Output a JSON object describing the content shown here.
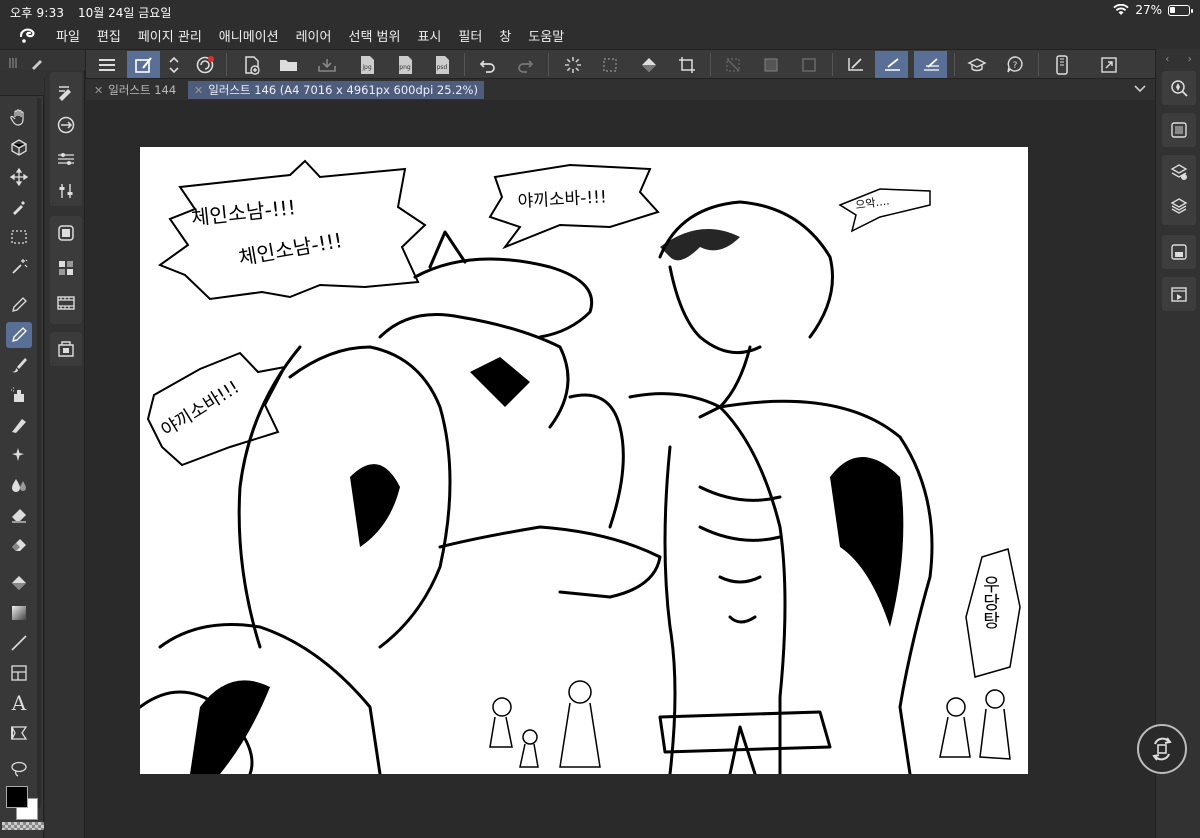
{
  "status_bar": {
    "time": "오후 9:33",
    "date": "10월 24일 금요일",
    "battery_percent": "27%",
    "battery_level": 0.27
  },
  "menu": {
    "items": [
      "파일",
      "편집",
      "페이지 관리",
      "애니메이션",
      "레이어",
      "선택 범위",
      "표시",
      "필터",
      "창",
      "도움말"
    ]
  },
  "toolbar": {
    "icons": [
      "menu-icon",
      "select-tool-icon",
      "updown-icon",
      "clip-studio-icon",
      "new-file-icon",
      "open-folder-icon",
      "save-icon",
      "export-jpg-icon",
      "export-png-icon",
      "export-psd-icon",
      "undo-icon",
      "redo-icon",
      "loading-icon",
      "transform-icon",
      "fill-icon",
      "crop-icon",
      "clear-icon",
      "fill-gray-icon",
      "border-icon",
      "snap-ruler-icon",
      "snap-special-icon",
      "snap-grid-icon",
      "learn-icon",
      "help-icon",
      "smartphone-icon",
      "expand-icon"
    ],
    "export_labels": {
      "jpg": "jpg",
      "png": "png",
      "psd": "psd"
    }
  },
  "tabs": [
    {
      "label": "일러스트 144",
      "active": false
    },
    {
      "label": "일러스트 146 (A4 7016 x 4961px 600dpi 25.2%)",
      "active": true
    }
  ],
  "canvas": {
    "bubbles": {
      "b1_line1": "체인소남-!!!",
      "b1_line2": "체인소남-!!!",
      "b2": "야끼소바-!!!",
      "b3": "야끼소바!!!",
      "b4": "으악....",
      "b5": "우당탕"
    }
  },
  "tools": [
    "hand-icon",
    "rotate-3d-icon",
    "move-icon",
    "eyedropper-icon",
    "marquee-icon",
    "magic-wand-icon",
    "pen-icon",
    "pen-active-icon",
    "brush-icon",
    "airbrush-icon",
    "eraser-pencil-icon",
    "sparkle-icon",
    "blend-icon",
    "eraser-icon",
    "eraser-fill-icon",
    "fill-bucket-icon",
    "gradient-icon",
    "line-icon",
    "frame-icon",
    "text-icon",
    "balloon-icon",
    "lasso-icon"
  ],
  "text_tool_label": "A",
  "colors": {
    "main": "#000000",
    "sub": "#ffffff",
    "accent": "#5a6f95",
    "bg": "#2b2b2b"
  }
}
